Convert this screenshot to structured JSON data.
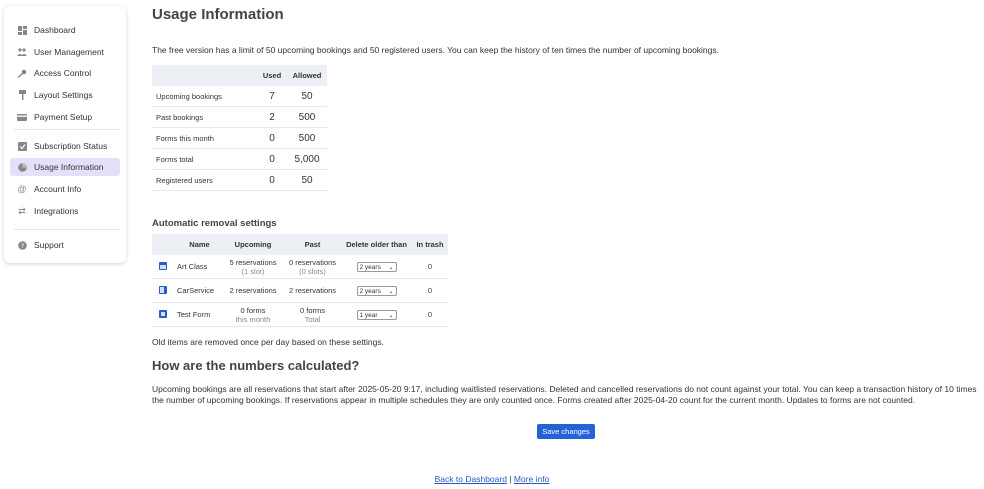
{
  "sidebar": {
    "items": [
      {
        "label": "Dashboard",
        "icon": "dashboard-icon"
      },
      {
        "label": "User Management",
        "icon": "users-icon"
      },
      {
        "label": "Access Control",
        "icon": "key-icon"
      },
      {
        "label": "Layout Settings",
        "icon": "paint-roller-icon"
      },
      {
        "label": "Payment Setup",
        "icon": "credit-card-icon"
      },
      {
        "label": "Subscription Status",
        "icon": "check-square-icon"
      },
      {
        "label": "Usage Information",
        "icon": "pie-chart-icon",
        "active": true
      },
      {
        "label": "Account Info",
        "icon": "at-icon"
      },
      {
        "label": "Integrations",
        "icon": "arrows-exchange-icon"
      },
      {
        "label": "Support",
        "icon": "help-circle-icon"
      }
    ],
    "active_color": "#e3e0fb"
  },
  "main": {
    "title": "Usage Information",
    "intro": "The free version has a limit of 50 upcoming bookings and 50 registered users. You can keep the history of ten times the number of upcoming bookings.",
    "usage_table": {
      "headers": [
        "",
        "Used",
        "Allowed"
      ],
      "rows": [
        {
          "label": "Upcoming bookings",
          "used": "7",
          "allowed": "50"
        },
        {
          "label": "Past bookings",
          "used": "2",
          "allowed": "500"
        },
        {
          "label": "Forms this month",
          "used": "0",
          "allowed": "500"
        },
        {
          "label": "Forms total",
          "used": "0",
          "allowed": "5,000"
        },
        {
          "label": "Registered users",
          "used": "0",
          "allowed": "50"
        }
      ]
    },
    "removal": {
      "heading": "Automatic removal settings",
      "headers": [
        "",
        "Name",
        "Upcoming",
        "Past",
        "Delete older than",
        "In trash"
      ],
      "rows": [
        {
          "icon": "calendar-icon",
          "name": "Art Class",
          "upcoming": "5 reservations",
          "upcoming_sub": "(1 slot)",
          "past": "0 reservations",
          "past_sub": "(0 slots)",
          "delete": "2 years",
          "trash": "0"
        },
        {
          "icon": "car-icon",
          "name": "CarService",
          "upcoming": "2 reservations",
          "upcoming_sub": "",
          "past": "2 reservations",
          "past_sub": "",
          "delete": "2 years",
          "trash": "0"
        },
        {
          "icon": "form-icon",
          "name": "Test Form",
          "upcoming": "0 forms",
          "upcoming_sub": "this month",
          "past": "0 forms",
          "past_sub": "Total",
          "delete": "1 year",
          "trash": "0"
        }
      ],
      "note": "Old items are removed once per day based on these settings."
    },
    "calc": {
      "heading": "How are the numbers calculated?",
      "text": "Upcoming bookings are all reservations that start after 2025-05-20 9:17, including waitlisted reservations. Deleted and cancelled reservations do not count against your total. You can keep a transaction history of 10 times the number of upcoming bookings. If reservations appear in multiple schedules they are only counted once. Forms created after 2025-04-20 count for the current month. Updates to forms are not counted."
    },
    "save_label": "Save changes"
  },
  "footer": {
    "back_label": "Back to Dashboard",
    "separator": "|",
    "more_label": "More info"
  },
  "colors": {
    "accent": "#2463d6",
    "link": "#2458c6",
    "header_bg": "#eceff3"
  }
}
